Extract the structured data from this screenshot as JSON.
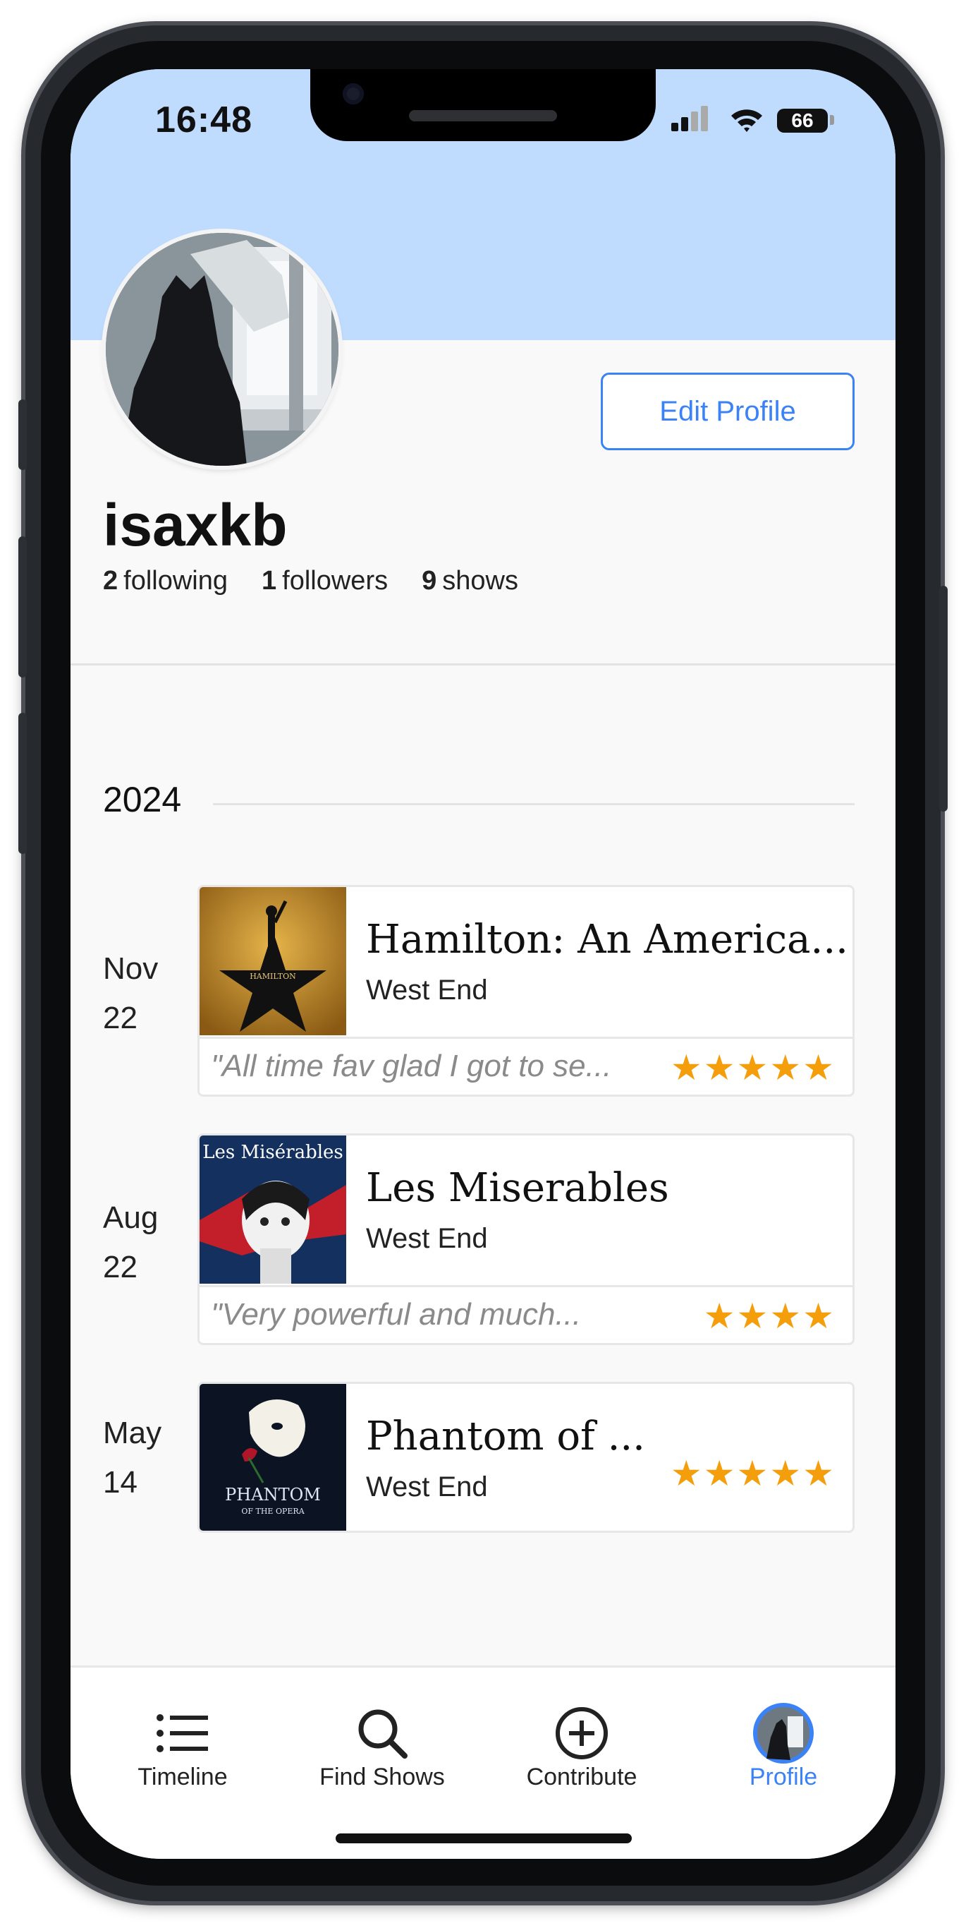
{
  "status_bar": {
    "time": "16:48",
    "battery": "66"
  },
  "profile": {
    "edit_label": "Edit Profile",
    "username": "isaxkb",
    "following_count": "2",
    "following_label": "following",
    "followers_count": "1",
    "followers_label": "followers",
    "shows_count": "9",
    "shows_label": "shows"
  },
  "timeline": {
    "year": "2024",
    "entries": [
      {
        "month": "Nov",
        "day": "22",
        "title": "Hamilton: An America...",
        "venue": "West End",
        "review": "\"All time fav glad I got to se...",
        "stars": "★★★★★",
        "poster_text": "HAMILTON"
      },
      {
        "month": "Aug",
        "day": "22",
        "title": "Les Miserables",
        "venue": "West End",
        "review": "\"Very powerful and much...",
        "stars": "★★★★",
        "poster_text": "Les Misérables"
      },
      {
        "month": "May",
        "day": "14",
        "title": "Phantom of ...",
        "venue": "West End",
        "review": "",
        "stars": "★★★★★",
        "poster_text": "PHANTOM",
        "poster_sub": "OF THE OPERA"
      }
    ]
  },
  "tabbar": {
    "tabs": [
      {
        "label": "Timeline",
        "icon": "list-icon"
      },
      {
        "label": "Find Shows",
        "icon": "search-icon"
      },
      {
        "label": "Contribute",
        "icon": "plus-circle-icon"
      },
      {
        "label": "Profile",
        "icon": "avatar-icon",
        "active": true
      }
    ]
  },
  "colors": {
    "accent": "#3b82f6",
    "banner": "#bfdbfe",
    "star": "#f59e0b"
  }
}
